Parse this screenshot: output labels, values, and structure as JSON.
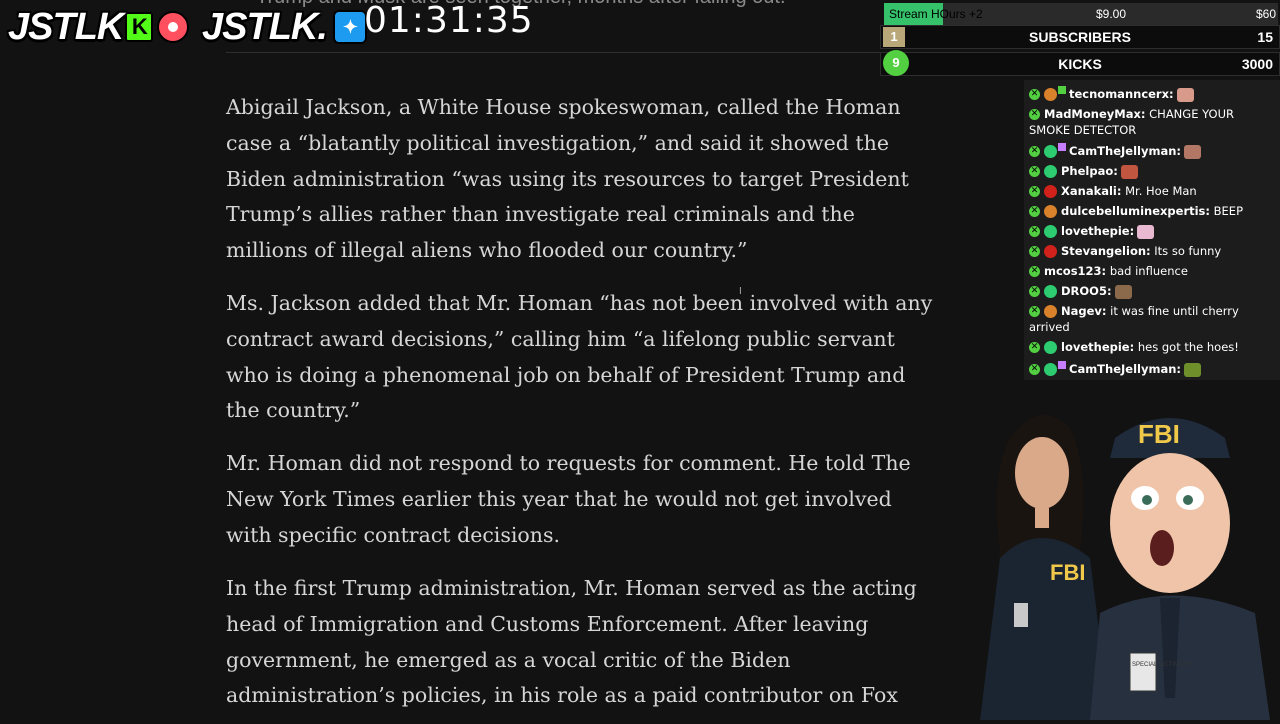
{
  "overlay": {
    "logo_left": "JSTLK",
    "logo_right": "JSTLK",
    "logo_right_suffix": ".",
    "timer": "01:31:35"
  },
  "article": {
    "top_bullet": "Trump and Musk are seen together, months after falling out.",
    "paragraphs": [
      "Abigail Jackson, a White House spokeswoman, called the Homan case a “blatantly political investigation,” and said it showed the Biden administration “was using its resources to target President Trump’s allies rather than investigate real criminals and the millions of illegal aliens who flooded our country.”",
      "Ms. Jackson added that Mr. Homan “has not been involved with any contract award decisions,” calling him “a lifelong public servant who is doing a phenomenal job on behalf of President Trump and the country.”",
      "Mr. Homan did not respond to requests for comment. He told The New York Times earlier this year that he would not get involved with specific contract decisions.",
      "In the first Trump administration, Mr. Homan served as the acting head of Immigration and Customs Enforcement. After leaving government, he emerged as a vocal critic of the Biden administration’s policies, in his role as a paid contributor on Fox"
    ]
  },
  "goals": {
    "stream_hours": {
      "label": "Stream HOurs +2",
      "current": "$9.00",
      "target": "$60",
      "progress": 0.15
    },
    "subscribers": {
      "badge": "1",
      "title": "SUBSCRIBERS",
      "count": "15"
    },
    "kicks": {
      "badge": "9",
      "title": "KICKS",
      "count": "3000"
    }
  },
  "chat": {
    "messages": [
      {
        "user": "tecnomanncerx:",
        "text": "",
        "avatar_color": "#d9822b",
        "sub": "green",
        "emote": "#d89a8a"
      },
      {
        "user": "MadMoneyMax:",
        "text": "CHANGE YOUR SMOKE DETECTOR",
        "avatar_color": "",
        "sub": "",
        "emote": ""
      },
      {
        "user": "CamTheJellyman:",
        "text": "",
        "avatar_color": "#2ecc71",
        "sub": "purple",
        "emote": "#b37766"
      },
      {
        "user": "Phelpao:",
        "text": "",
        "avatar_color": "#2ecc71",
        "sub": "",
        "emote": "#c0563f"
      },
      {
        "user": "Xanakali:",
        "text": "Mr. Hoe Man",
        "avatar_color": "#d0221b",
        "sub": "",
        "emote": ""
      },
      {
        "user": "dulcebelluminexpertis:",
        "text": "BEEP",
        "avatar_color": "#d9822b",
        "sub": "",
        "emote": ""
      },
      {
        "user": "lovethepie:",
        "text": "",
        "avatar_color": "#2ecc71",
        "sub": "",
        "emote": "#e8b9d0"
      },
      {
        "user": "Stevangelion:",
        "text": "Its so funny",
        "avatar_color": "#d0221b",
        "sub": "",
        "emote": ""
      },
      {
        "user": "mcos123:",
        "text": "bad influence",
        "avatar_color": "",
        "sub": "",
        "emote": ""
      },
      {
        "user": "DROO5:",
        "text": "",
        "avatar_color": "#2ecc71",
        "sub": "",
        "emote": "#8a6a4a"
      },
      {
        "user": "Nagev:",
        "text": "it was fine until cherry arrived",
        "avatar_color": "#d9822b",
        "sub": "",
        "emote": ""
      },
      {
        "user": "lovethepie:",
        "text": "hes got the hoes!",
        "avatar_color": "#2ecc71",
        "sub": "",
        "emote": ""
      },
      {
        "user": "CamTheJellyman:",
        "text": "",
        "avatar_color": "#2ecc71",
        "sub": "purple",
        "emote": "#6f8f2a"
      }
    ]
  },
  "characters": {
    "badge_text": "FBI",
    "cap_text": "FBI",
    "lanyard_text": "SPECIAL VICTIMS FBI"
  }
}
